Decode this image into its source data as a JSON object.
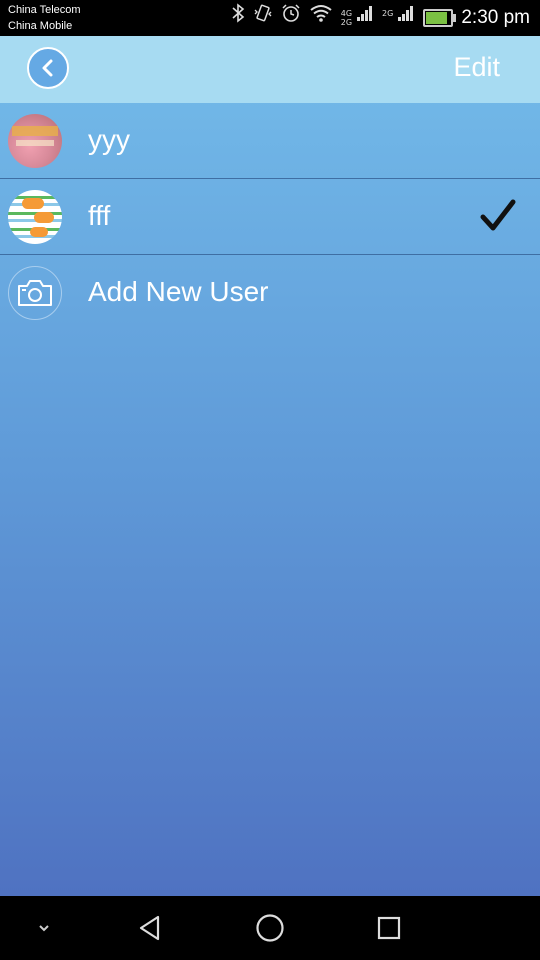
{
  "status_bar": {
    "carrier_1": "China Telecom",
    "carrier_2": "China Mobile",
    "net_4g": "4G",
    "net_2g_a": "2G",
    "net_2g_b": "2G",
    "time": "2:30 pm",
    "icons": [
      "bluetooth-icon",
      "vibrate-icon",
      "alarm-icon",
      "wifi-icon",
      "signal-icon",
      "signal-icon",
      "battery-icon"
    ],
    "battery_level": 0.8
  },
  "header": {
    "back_icon": "chevron-left-icon",
    "edit_label": "Edit"
  },
  "users": [
    {
      "name": "yyy",
      "avatar": "photo",
      "selected": false
    },
    {
      "name": "fff",
      "avatar": "stripes",
      "selected": true
    },
    {
      "name": "Add New User",
      "avatar": "camera-icon",
      "selected": false
    }
  ],
  "nav_bar": {
    "icons": [
      "chevron-down-icon",
      "back-triangle-icon",
      "home-circle-icon",
      "recents-square-icon"
    ]
  },
  "colors": {
    "header_bg": "#a7dbf2",
    "list_gradient_top": "#74bcea",
    "list_gradient_bottom": "#4f72c1",
    "divider": "#3f6ea3"
  }
}
